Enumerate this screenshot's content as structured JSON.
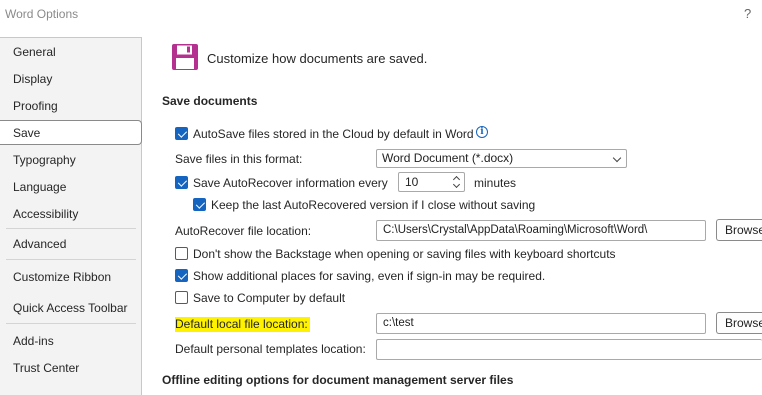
{
  "window": {
    "title": "Word Options",
    "help": "?"
  },
  "sidebar": {
    "items": [
      {
        "label": "General"
      },
      {
        "label": "Display"
      },
      {
        "label": "Proofing"
      },
      {
        "label": "Save",
        "selected": true
      },
      {
        "label": "Typography"
      },
      {
        "label": "Language"
      },
      {
        "label": "Accessibility"
      },
      {
        "label": "Advanced"
      },
      {
        "label": "Customize Ribbon"
      },
      {
        "label": "Quick Access Toolbar"
      },
      {
        "label": "Add-ins"
      },
      {
        "label": "Trust Center"
      }
    ]
  },
  "main": {
    "header": "Customize how documents are saved.",
    "save_documents": {
      "heading": "Save documents",
      "autosave_label": "AutoSave files stored in the Cloud by default in Word",
      "autosave_checked": true,
      "format_label": "Save files in this format:",
      "format_value": "Word Document (*.docx)",
      "autorecover_label": "Save AutoRecover information every",
      "autorecover_checked": true,
      "autorecover_minutes": "10",
      "minutes_label": "minutes",
      "keep_last_label": "Keep the last AutoRecovered version if I close without saving",
      "keep_last_checked": true,
      "autorecover_location_label": "AutoRecover file location:",
      "autorecover_location_value": "C:\\Users\\Crystal\\AppData\\Roaming\\Microsoft\\Word\\",
      "browse_label": "Browse",
      "backstage_label": "Don't show the Backstage when opening or saving files with keyboard shortcuts",
      "backstage_checked": false,
      "additional_places_label": "Show additional places for saving, even if sign-in may be required.",
      "additional_places_checked": true,
      "save_to_computer_label": "Save to Computer by default",
      "save_to_computer_checked": false,
      "default_local_label": "Default local file location:",
      "default_local_value": "c:\\test",
      "browse_label_2": "Browse",
      "default_templates_label": "Default personal templates location:",
      "default_templates_value": ""
    },
    "offline_heading": "Offline editing options for document management server files"
  },
  "colors": {
    "accent": "#1565c0",
    "highlight": "#fff200",
    "save_icon": "#b5318f"
  },
  "icons": [
    "save-disk-icon",
    "info-icon",
    "chevron-down-icon",
    "spin-up-icon",
    "spin-down-icon"
  ]
}
